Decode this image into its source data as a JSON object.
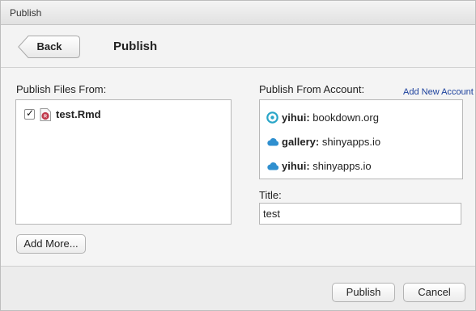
{
  "window": {
    "title": "Publish"
  },
  "header": {
    "back_label": "Back",
    "title": "Publish"
  },
  "files": {
    "label": "Publish Files From:",
    "items": [
      {
        "name": "test.Rmd",
        "checked": true,
        "icon": "rmarkdown-file-icon"
      }
    ],
    "add_more_label": "Add More..."
  },
  "accounts": {
    "label": "Publish From Account:",
    "add_new_label": "Add New Account",
    "items": [
      {
        "name": "yihui:",
        "server": "bookdown.org",
        "icon": "rstudio-connect-icon"
      },
      {
        "name": "gallery:",
        "server": "shinyapps.io",
        "icon": "cloud-icon"
      },
      {
        "name": "yihui:",
        "server": "shinyapps.io",
        "icon": "cloud-icon"
      }
    ]
  },
  "title_field": {
    "label": "Title:",
    "value": "test"
  },
  "footer": {
    "publish_label": "Publish",
    "cancel_label": "Cancel"
  },
  "colors": {
    "link": "#1a3f9c",
    "cloud_icon": "#2f8fcf",
    "connect_icon": "#2aa6c8"
  }
}
